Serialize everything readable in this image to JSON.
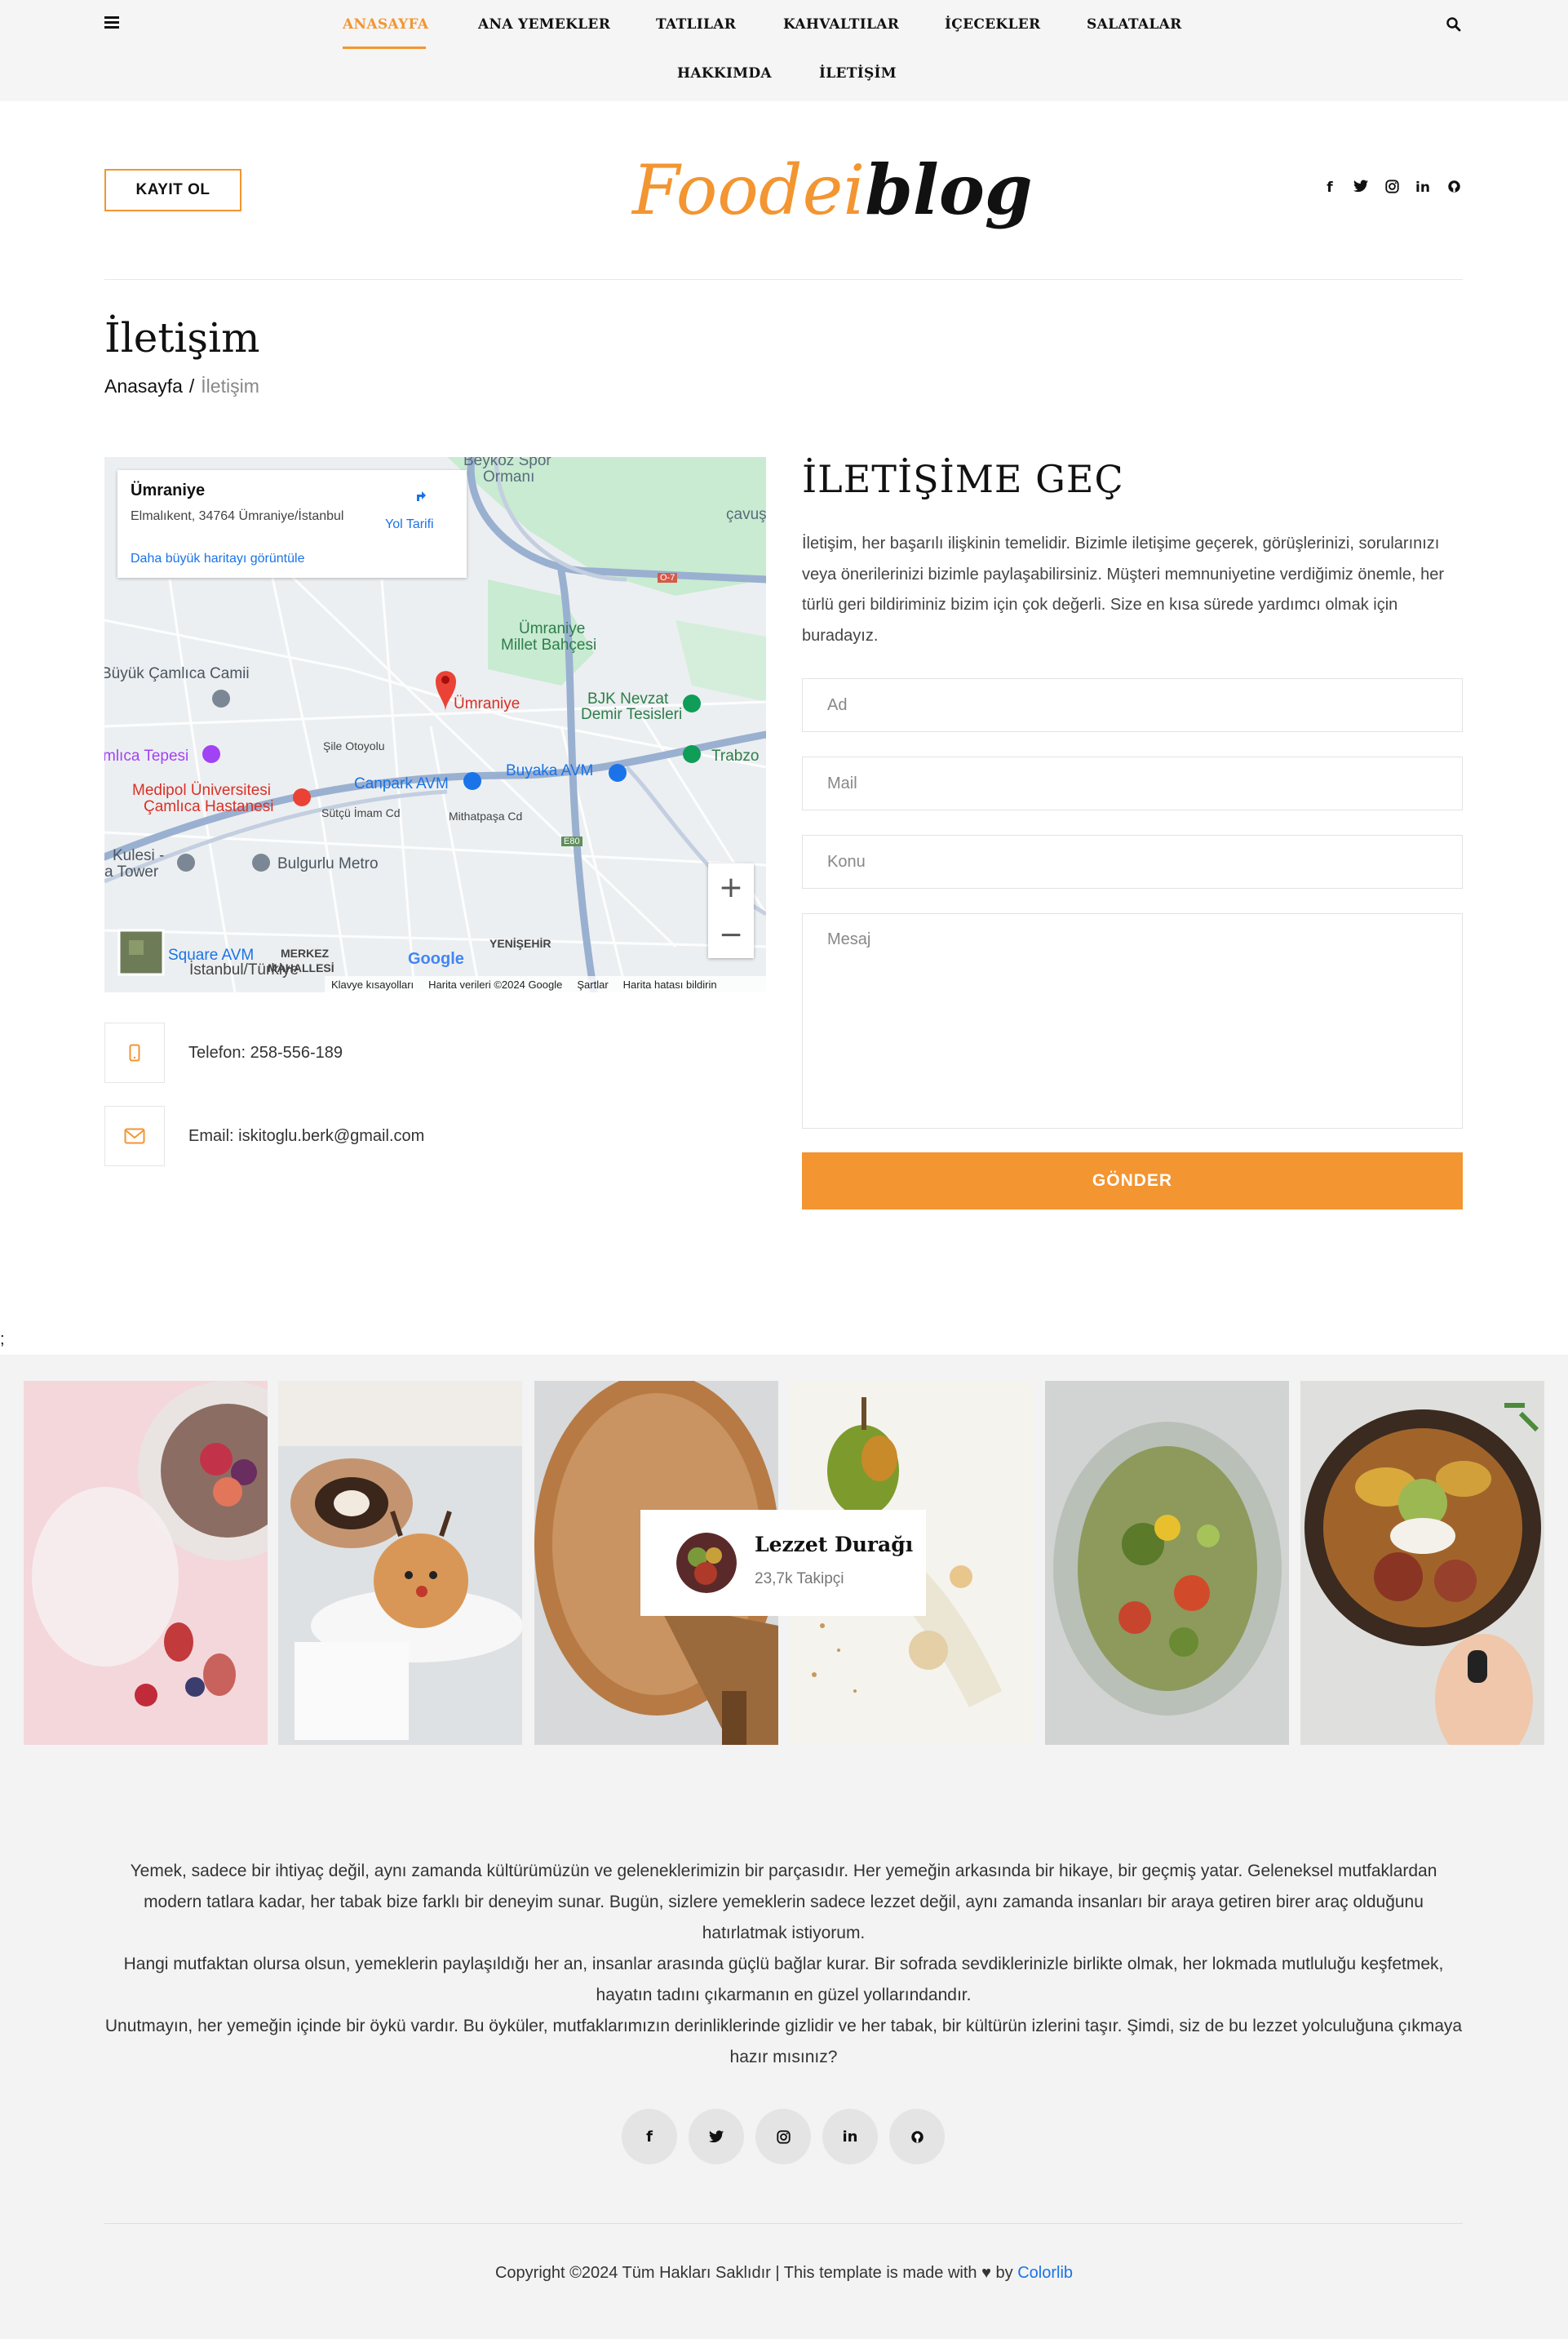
{
  "nav": {
    "items": [
      {
        "label": "ANASAYFA",
        "active": true
      },
      {
        "label": "ANA YEMEKLER"
      },
      {
        "label": "TATLILAR"
      },
      {
        "label": "KAHVALTILAR"
      },
      {
        "label": "İÇECEKLER"
      },
      {
        "label": "SALATALAR"
      },
      {
        "label": "HAKKIMDA"
      },
      {
        "label": "İLETİŞİM"
      }
    ],
    "menu_icon": "hamburger-icon",
    "search_icon": "search-icon"
  },
  "header": {
    "register_label": "KAYIT OL",
    "logo_part1": "Foodei",
    "logo_part2": "blog",
    "social_icons": [
      "facebook-icon",
      "twitter-icon",
      "instagram-icon",
      "linkedin-icon",
      "github-icon"
    ]
  },
  "page": {
    "title": "İletişim",
    "breadcrumb_home": "Anasayfa",
    "breadcrumb_sep": "/",
    "breadcrumb_current": "İletişim"
  },
  "map": {
    "place_name": "Ümraniye",
    "address": "Elmalıkent, 34764 Ümraniye/İstanbul",
    "directions_label": "Yol Tarifi",
    "larger_map_label": "Daha büyük haritayı görüntüle",
    "pin_label": "Ümraniye",
    "labels": {
      "beykoz": "Beykoz Spor",
      "ormani": "Ormanı",
      "cavus": "çavuş",
      "millet1": "Ümraniye",
      "millet2": "Millet Bahçesi",
      "camlica": "Büyük Çamlıca Camii",
      "bjk1": "BJK Nevzat",
      "bjk2": "Demir Tesisleri",
      "tepesi": "mlıca Tepesi",
      "trabzon": "Trabzo",
      "canpark": "Canpark AVM",
      "buyaka": "Buyaka AVM",
      "medipol1": "Medipol Üniversitesi",
      "medipol2": "Çamlıca Hastanesi",
      "sutcu": "Sütçü İmam Cd",
      "mithatpasa": "Mithatpaşa Cd",
      "sile": "Şile Otoyolu",
      "kulesi1": "Kulesi -",
      "kulesi2": "a Tower",
      "bulgurlu": "Bulgurlu Metro",
      "square": "Square AVM",
      "istanbul": "İstanbul/Türkiye",
      "merkez1": "MERKEZ",
      "merkez2": "MAHALLESİ",
      "yenisehir": "YENİŞEHİR",
      "e80": "E80",
      "o7": "O-7",
      "google": "Google"
    },
    "footer": [
      "Klavye kısayolları",
      "Harita verileri ©2024 Google",
      "Şartlar",
      "Harita hatası bildirin"
    ],
    "zoom_in": "+",
    "zoom_out": "−"
  },
  "contact": {
    "phone": "Telefon: 258-556-189",
    "email": "Email: iskitoglu.berk@gmail.com",
    "phone_icon": "phone-icon",
    "email_icon": "envelope-icon"
  },
  "form": {
    "title": "İLETİŞİME GEÇ",
    "description": "İletişim, her başarılı ilişkinin temelidir. Bizimle iletişime geçerek, görüşlerinizi, sorularınızı veya önerilerinizi bizimle paylaşabilirsiniz. Müşteri memnuniyetine verdiğimiz önemle, her türlü geri bildiriminiz bizim için çok değerli. Size en kısa sürede yardımcı olmak için buradayız.",
    "name_placeholder": "Ad",
    "mail_placeholder": "Mail",
    "subject_placeholder": "Konu",
    "message_placeholder": "Mesaj",
    "submit_label": "GÖNDER"
  },
  "stray_text": ";",
  "instagram": {
    "account_name": "Lezzet Durağı",
    "followers": "23,7k Takipçi"
  },
  "footer": {
    "paragraph1": "Yemek, sadece bir ihtiyaç değil, aynı zamanda kültürümüzün ve geleneklerimizin bir parçasıdır. Her yemeğin arkasında bir hikaye, bir geçmiş yatar. Geleneksel mutfaklardan modern tatlara kadar, her tabak bize farklı bir deneyim sunar. Bugün, sizlere yemeklerin sadece lezzet değil, aynı zamanda insanları bir araya getiren birer araç olduğunu hatırlatmak istiyorum.",
    "paragraph2": "Hangi mutfaktan olursa olsun, yemeklerin paylaşıldığı her an, insanlar arasında güçlü bağlar kurar. Bir sofrada sevdiklerinizle birlikte olmak, her lokmada mutluluğu keşfetmek, hayatın tadını çıkarmanın en güzel yollarındandır.",
    "paragraph3": "Unutmayın, her yemeğin içinde bir öykü vardır. Bu öyküler, mutfaklarımızın derinliklerinde gizlidir ve her tabak, bir kültürün izlerini taşır. Şimdi, siz de bu lezzet yolculuğuna çıkmaya hazır mısınız?",
    "social_icons": [
      "facebook-icon",
      "twitter-icon",
      "instagram-icon",
      "linkedin-icon",
      "github-icon"
    ],
    "copyright_prefix": "Copyright ©2024 Tüm Hakları Saklıdır | This template is made with ",
    "heart": "♥",
    "by": " by ",
    "colorlib": "Colorlib"
  },
  "colors": {
    "accent": "#f39531",
    "link": "#1a73e8"
  }
}
